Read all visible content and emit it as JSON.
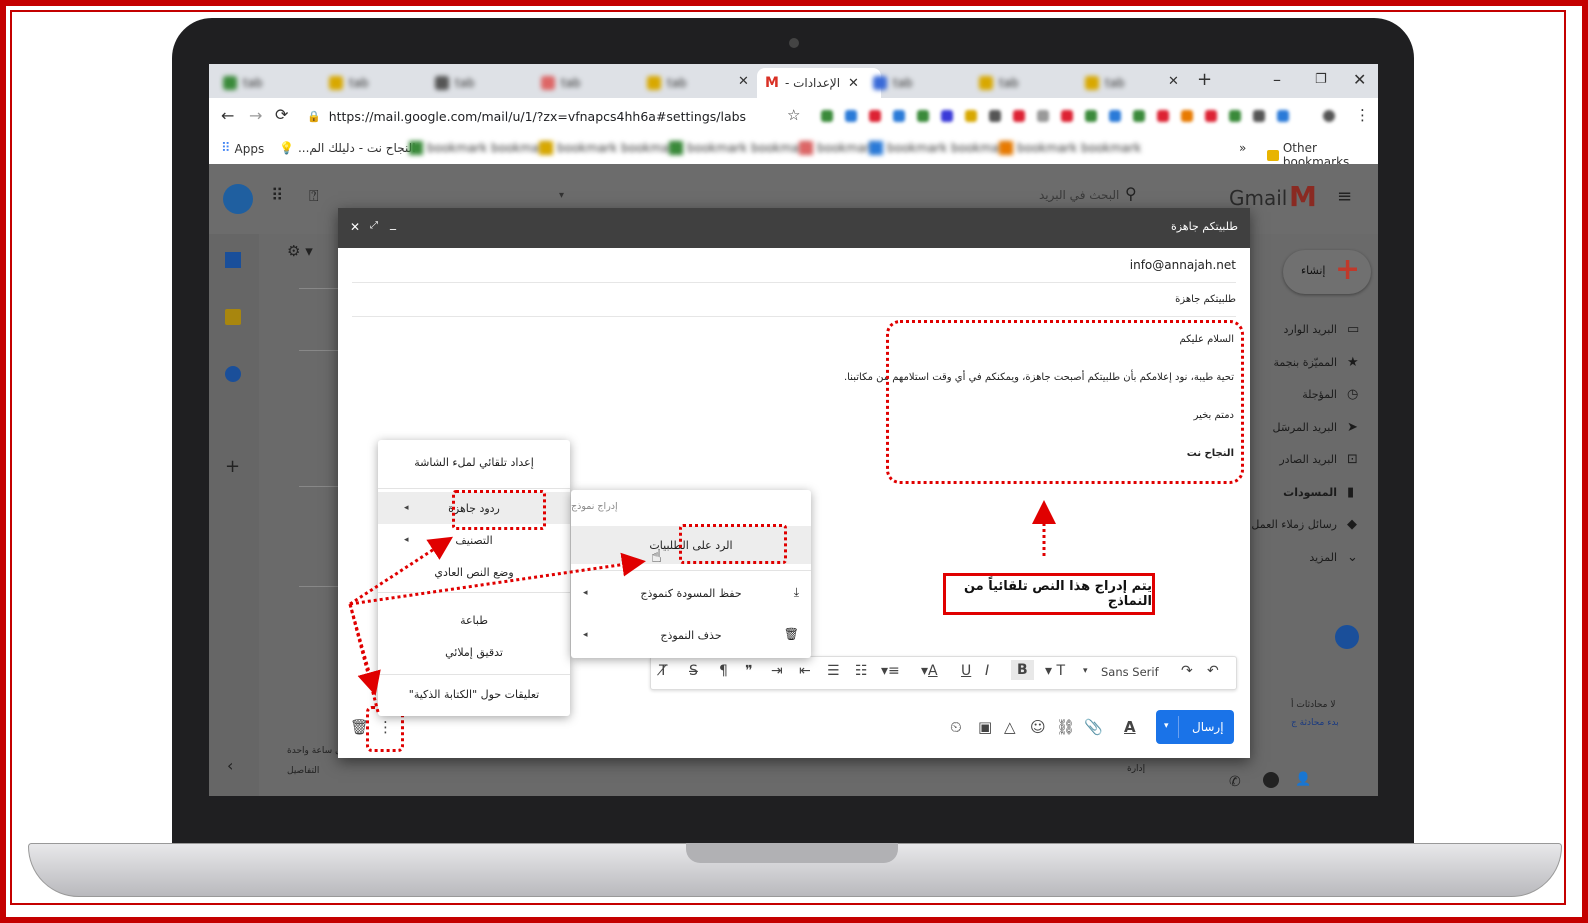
{
  "browser": {
    "active_tab_title": "الإعدادات -",
    "new_tab_symbol": "+",
    "url": "https://mail.google.com/mail/u/1/?zx=vfnapcs4hh6a#settings/labs",
    "apps_label": "Apps",
    "bookmark_1": "النجاح نت - دليلك الم...",
    "other_bookmarks": "Other bookmarks",
    "more_bookmarks": "»"
  },
  "gmail": {
    "logo_text": "Gmail",
    "search_placeholder": "البحث في البريد",
    "compose_label": "إنشاء",
    "sidebar": [
      {
        "label": "البريد الوارد",
        "icon": "inbox-icon"
      },
      {
        "label": "المميّزة بنجمة",
        "icon": "star-icon"
      },
      {
        "label": "المؤجلة",
        "icon": "clock-icon"
      },
      {
        "label": "البريد المرسَل",
        "icon": "send-icon"
      },
      {
        "label": "البريد الصادر",
        "icon": "outbox-icon"
      },
      {
        "label": "المسودات",
        "icon": "draft-icon"
      },
      {
        "label": "رسائل زملاء العمل",
        "icon": "label-icon"
      },
      {
        "label": "المزيد",
        "icon": "chevron-down-icon"
      }
    ],
    "hangouts_text_1": "لا محادثات أ",
    "hangouts_text_2": "بدء محادثة ج",
    "footer_left_1": "ل ساعة واحدة",
    "footer_left_2": "التفاصيل",
    "footer_manage": "إدارة"
  },
  "compose": {
    "title": "طلبيتكم جاهزة",
    "to": "info@annajah.net",
    "subject": "طلبيتكم جاهزة",
    "body": {
      "greeting": "السلام عليكم",
      "line": "تحية طيبة، نود إعلامكم بأن طلبيتكم أصبحت جاهزة، ويمكنكم في أي وقت استلامهم من مكاتبنا.",
      "closing": "دمتم بخير",
      "signature": "النجاح نت"
    },
    "font_name": "Sans Serif",
    "send_label": "إرسال",
    "format_letter_a": "A"
  },
  "more_menu": {
    "items": [
      "إعداد تلقائي لملء الشاشة",
      "ردود جاهزة",
      "التصنيف",
      "وضع النص العادي",
      "طباعة",
      "تدقيق إملائي",
      "تعليقات حول \"الكتابة الذكية\""
    ]
  },
  "templates_menu": {
    "header": "إدراج نموذج",
    "items": [
      "الرد على الطلبيات",
      "حفظ المسودة كنموذج",
      "حذف النموذج"
    ]
  },
  "annotation": {
    "text": "يتم إدراج هذا النص تلقائياً من النماذج",
    "color": "#e00000"
  }
}
